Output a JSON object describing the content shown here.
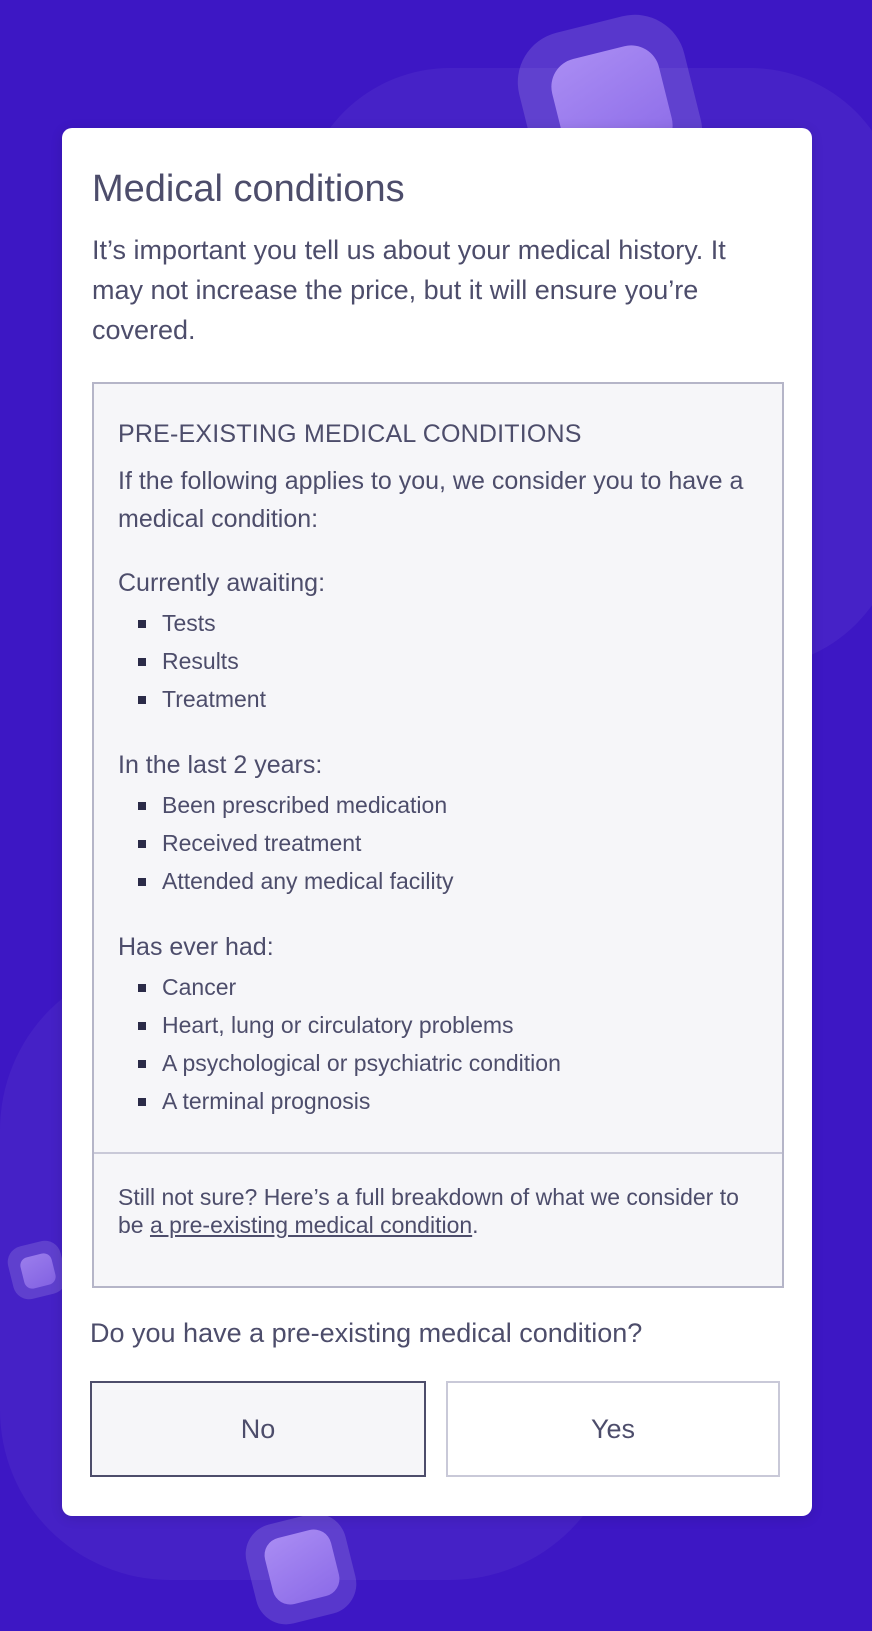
{
  "page": {
    "title": "Medical conditions",
    "intro": "It’s important you tell us about your medical history. It may not increase the price, but it will ensure you’re covered."
  },
  "info": {
    "heading": "PRE-EXISTING MEDICAL CONDITIONS",
    "lead": "If the following applies to you, we consider you to have a medical condition:",
    "groups": [
      {
        "title": "Currently awaiting:",
        "items": [
          "Tests",
          "Results",
          "Treatment"
        ]
      },
      {
        "title": "In the last 2 years:",
        "items": [
          "Been prescribed medication",
          "Received treatment",
          "Attended any medical facility"
        ]
      },
      {
        "title": "Has ever had:",
        "items": [
          "Cancer",
          "Heart, lung or circulatory problems",
          "A psychological or psychiatric condition",
          "A terminal prognosis"
        ]
      }
    ],
    "note_prefix": "Still not sure? Here’s a full breakdown of what we consider to be ",
    "note_link": "a pre-existing medical condition",
    "note_suffix": "."
  },
  "question": {
    "text": "Do you have a pre-existing medical condition?",
    "no_label": "No",
    "yes_label": "Yes"
  },
  "colors": {
    "background": "#3d17c4",
    "text": "#4d4d6b",
    "box_background": "#f6f6f9"
  }
}
